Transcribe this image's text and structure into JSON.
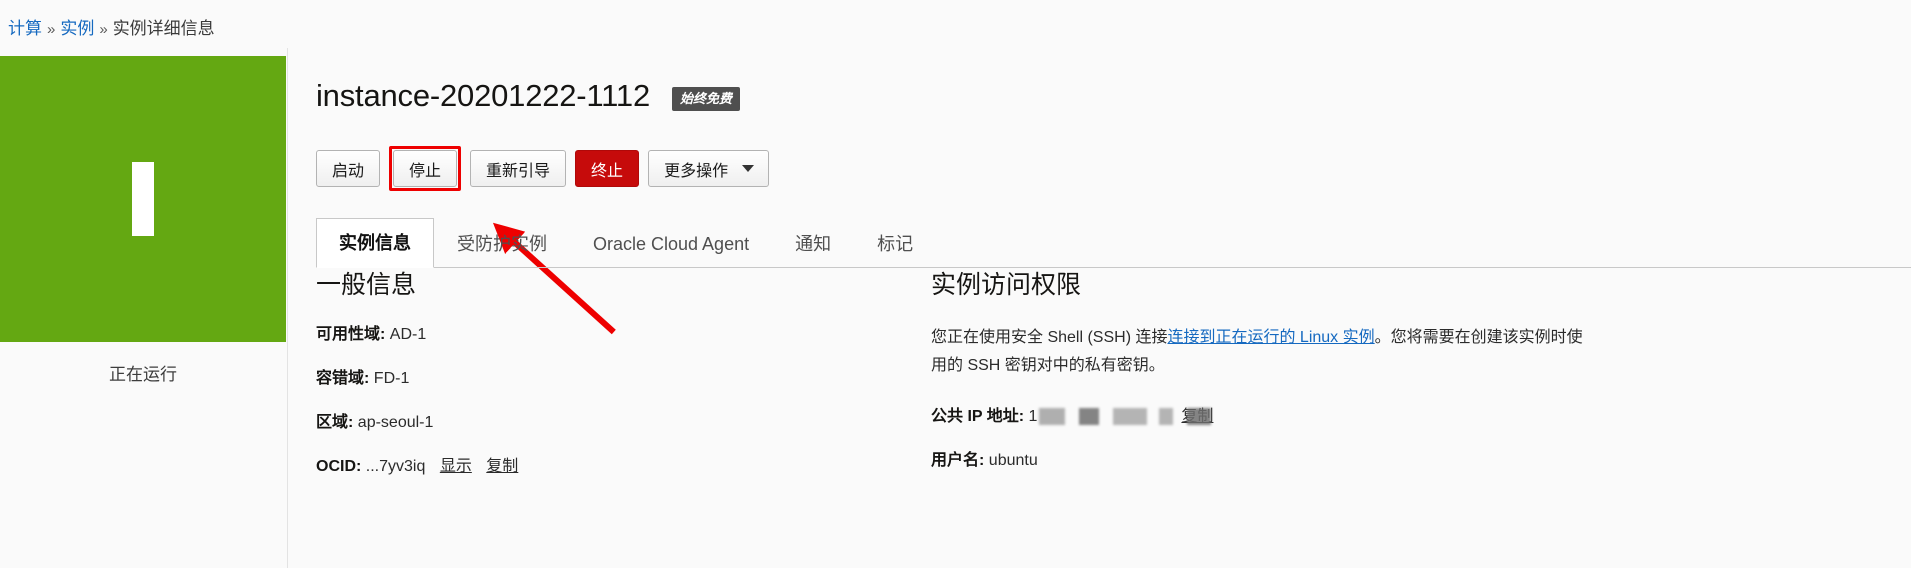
{
  "breadcrumb": {
    "items": [
      {
        "label": "计算",
        "link": true
      },
      {
        "label": "实例",
        "link": true
      },
      {
        "label": "实例详细信息",
        "link": false
      }
    ],
    "separator": "»"
  },
  "status_panel": {
    "state_label": "正在运行",
    "box_color": "#64a812",
    "glyph": "instance-running-bar-icon"
  },
  "header": {
    "title": "instance-20201222-1112",
    "badge": "始终免费",
    "badge_color": "#4f4f4f"
  },
  "actions": {
    "buttons": [
      {
        "label": "启动",
        "style": "default",
        "highlighted": false
      },
      {
        "label": "停止",
        "style": "default",
        "highlighted": true
      },
      {
        "label": "重新引导",
        "style": "default",
        "highlighted": false
      },
      {
        "label": "终止",
        "style": "danger",
        "highlighted": false
      },
      {
        "label": "更多操作",
        "style": "dropdown",
        "highlighted": false
      }
    ],
    "highlight_color": "#ee0000",
    "danger_color": "#c60b0b"
  },
  "annotation": {
    "arrow_color": "#ee0000",
    "arrow_target": "停止"
  },
  "tabs": [
    {
      "label": "实例信息",
      "active": true
    },
    {
      "label": "受防护实例",
      "active": false
    },
    {
      "label": "Oracle Cloud Agent",
      "active": false
    },
    {
      "label": "通知",
      "active": false
    },
    {
      "label": "标记",
      "active": false
    }
  ],
  "general_info": {
    "title": "一般信息",
    "fields": [
      {
        "label": "可用性域:",
        "value": "AD-1",
        "links": []
      },
      {
        "label": "容错域:",
        "value": "FD-1",
        "links": []
      },
      {
        "label": "区域:",
        "value": "ap-seoul-1",
        "links": []
      },
      {
        "label": "OCID:",
        "value": "...7yv3iq",
        "links": [
          "显示",
          "复制"
        ]
      }
    ]
  },
  "instance_access": {
    "title": "实例访问权限",
    "paragraph": {
      "line1_before": "您正在使用安全 Shell (SSH) 连接",
      "line1_link": "连接到正在运行的 Linux 实例",
      "line1_after": "。您将需要在创建该实例时使",
      "line2": "用的 SSH 密钥对中的私有密钥。"
    },
    "public_ip": {
      "label": "公共 IP 地址:",
      "value_prefix": "1",
      "value_redacted": true,
      "copy_link": "复制"
    },
    "username": {
      "label": "用户名:",
      "value": "ubuntu"
    }
  }
}
